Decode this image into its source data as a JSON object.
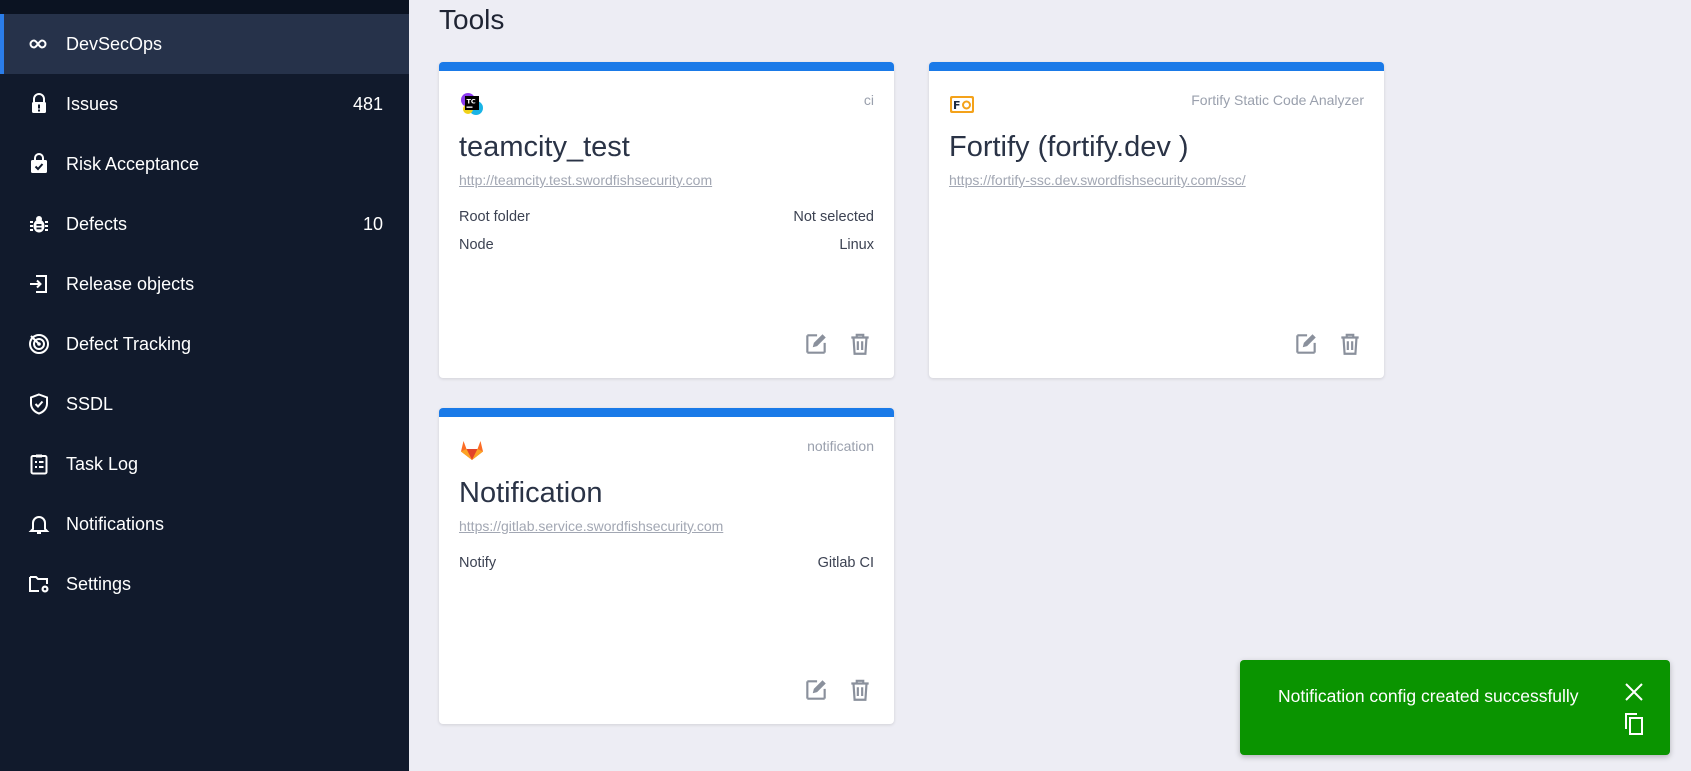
{
  "sidebar": {
    "items": [
      {
        "label": "DevSecOps",
        "icon": "infinity-icon",
        "count": ""
      },
      {
        "label": "Issues",
        "icon": "lock-alert-icon",
        "count": "481"
      },
      {
        "label": "Risk Acceptance",
        "icon": "shopping-bag-check-icon",
        "count": ""
      },
      {
        "label": "Defects",
        "icon": "bug-icon",
        "count": "10"
      },
      {
        "label": "Release objects",
        "icon": "login-box-icon",
        "count": ""
      },
      {
        "label": "Defect Tracking",
        "icon": "radar-icon",
        "count": ""
      },
      {
        "label": "SSDL",
        "icon": "shield-check-icon",
        "count": ""
      },
      {
        "label": "Task Log",
        "icon": "clipboard-list-icon",
        "count": ""
      },
      {
        "label": "Notifications",
        "icon": "bell-icon",
        "count": ""
      },
      {
        "label": "Settings",
        "icon": "folder-cog-icon",
        "count": ""
      }
    ],
    "active_index": 0
  },
  "main": {
    "title": "Tools",
    "cards": [
      {
        "type": "ci",
        "title": "teamcity_test",
        "url": "http://teamcity.test.swordfishsecurity.com",
        "logo": "teamcity-logo",
        "props": [
          {
            "label": "Root folder",
            "value": "Not selected"
          },
          {
            "label": "Node",
            "value": "Linux"
          }
        ]
      },
      {
        "type": "Fortify Static Code Analyzer",
        "title": "Fortify (fortify.dev )",
        "url": "https://fortify-ssc.dev.swordfishsecurity.com/ssc/",
        "logo": "fortify-logo",
        "props": []
      },
      {
        "type": "notification",
        "title": "Notification",
        "url": "https://gitlab.service.swordfishsecurity.com",
        "logo": "gitlab-logo",
        "props": [
          {
            "label": "Notify",
            "value": "Gitlab CI"
          }
        ]
      }
    ]
  },
  "toast": {
    "message": "Notification config created successfully"
  },
  "colors": {
    "sidebar_bg": "#111a2c",
    "sidebar_active": "#26324a",
    "accent": "#1a7ae8",
    "toast_bg": "#0a9400",
    "page_bg": "#ededf4"
  }
}
